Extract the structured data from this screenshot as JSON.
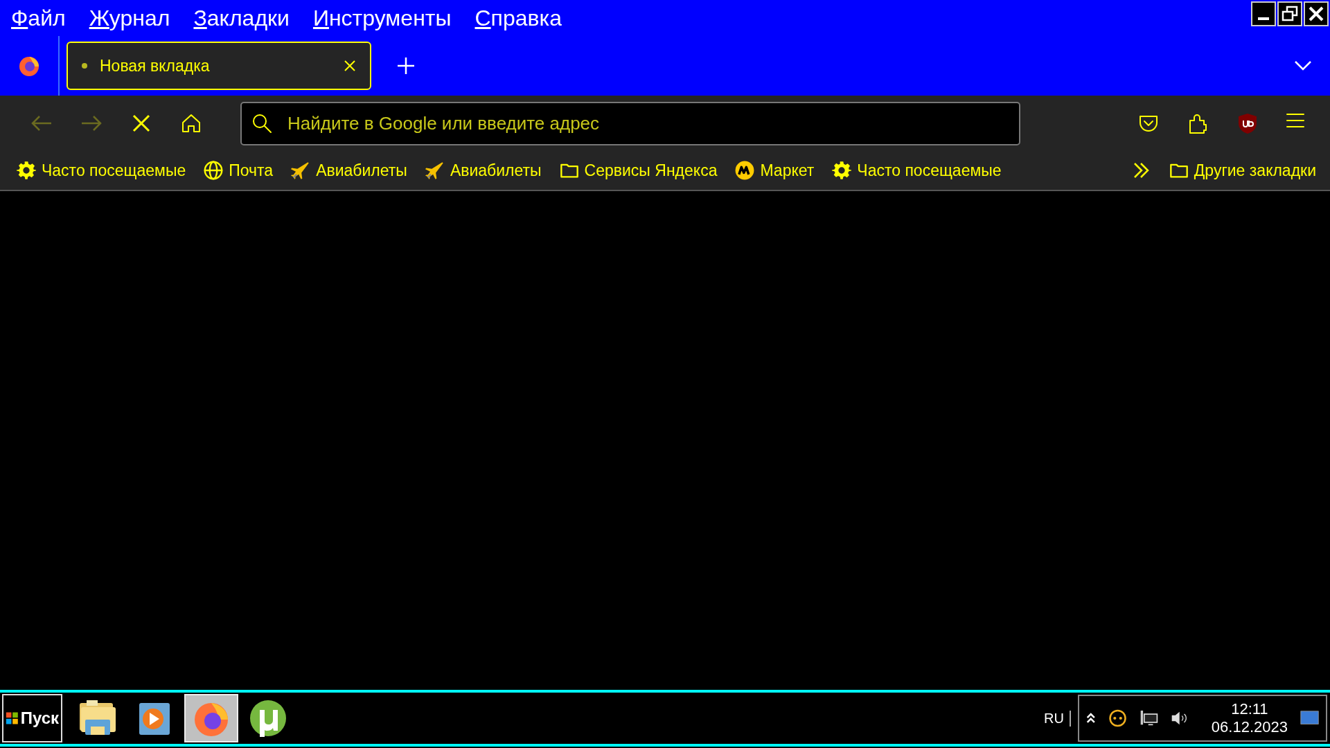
{
  "menu": [
    "Файл",
    "Журнал",
    "Закладки",
    "Инструменты",
    "Справка"
  ],
  "tabs": [
    {
      "label": "Новая вкладка",
      "selected": true
    }
  ],
  "address": {
    "placeholder": "Найдите в Google или введите адрес"
  },
  "bookmarks": [
    {
      "label": "Часто посещаемые",
      "kind": "gear"
    },
    {
      "label": "Почта",
      "kind": "globe"
    },
    {
      "label": "Авиабилеты",
      "kind": "plane"
    },
    {
      "label": "Авиабилеты",
      "kind": "plane"
    },
    {
      "label": "Сервисы Яндекса",
      "kind": "folder"
    },
    {
      "label": "Маркет",
      "kind": "market"
    },
    {
      "label": "Часто посещаемые",
      "kind": "gear"
    }
  ],
  "other_bookmarks": "Другие закладки",
  "taskbar": {
    "start": "Пуск",
    "apps": [
      {
        "kind": "explorer",
        "selected": false
      },
      {
        "kind": "player",
        "selected": false
      },
      {
        "kind": "firefox",
        "selected": true
      },
      {
        "kind": "torrent",
        "selected": false
      }
    ],
    "language": "RU",
    "time": "12:11",
    "date": "06.12.2023"
  }
}
